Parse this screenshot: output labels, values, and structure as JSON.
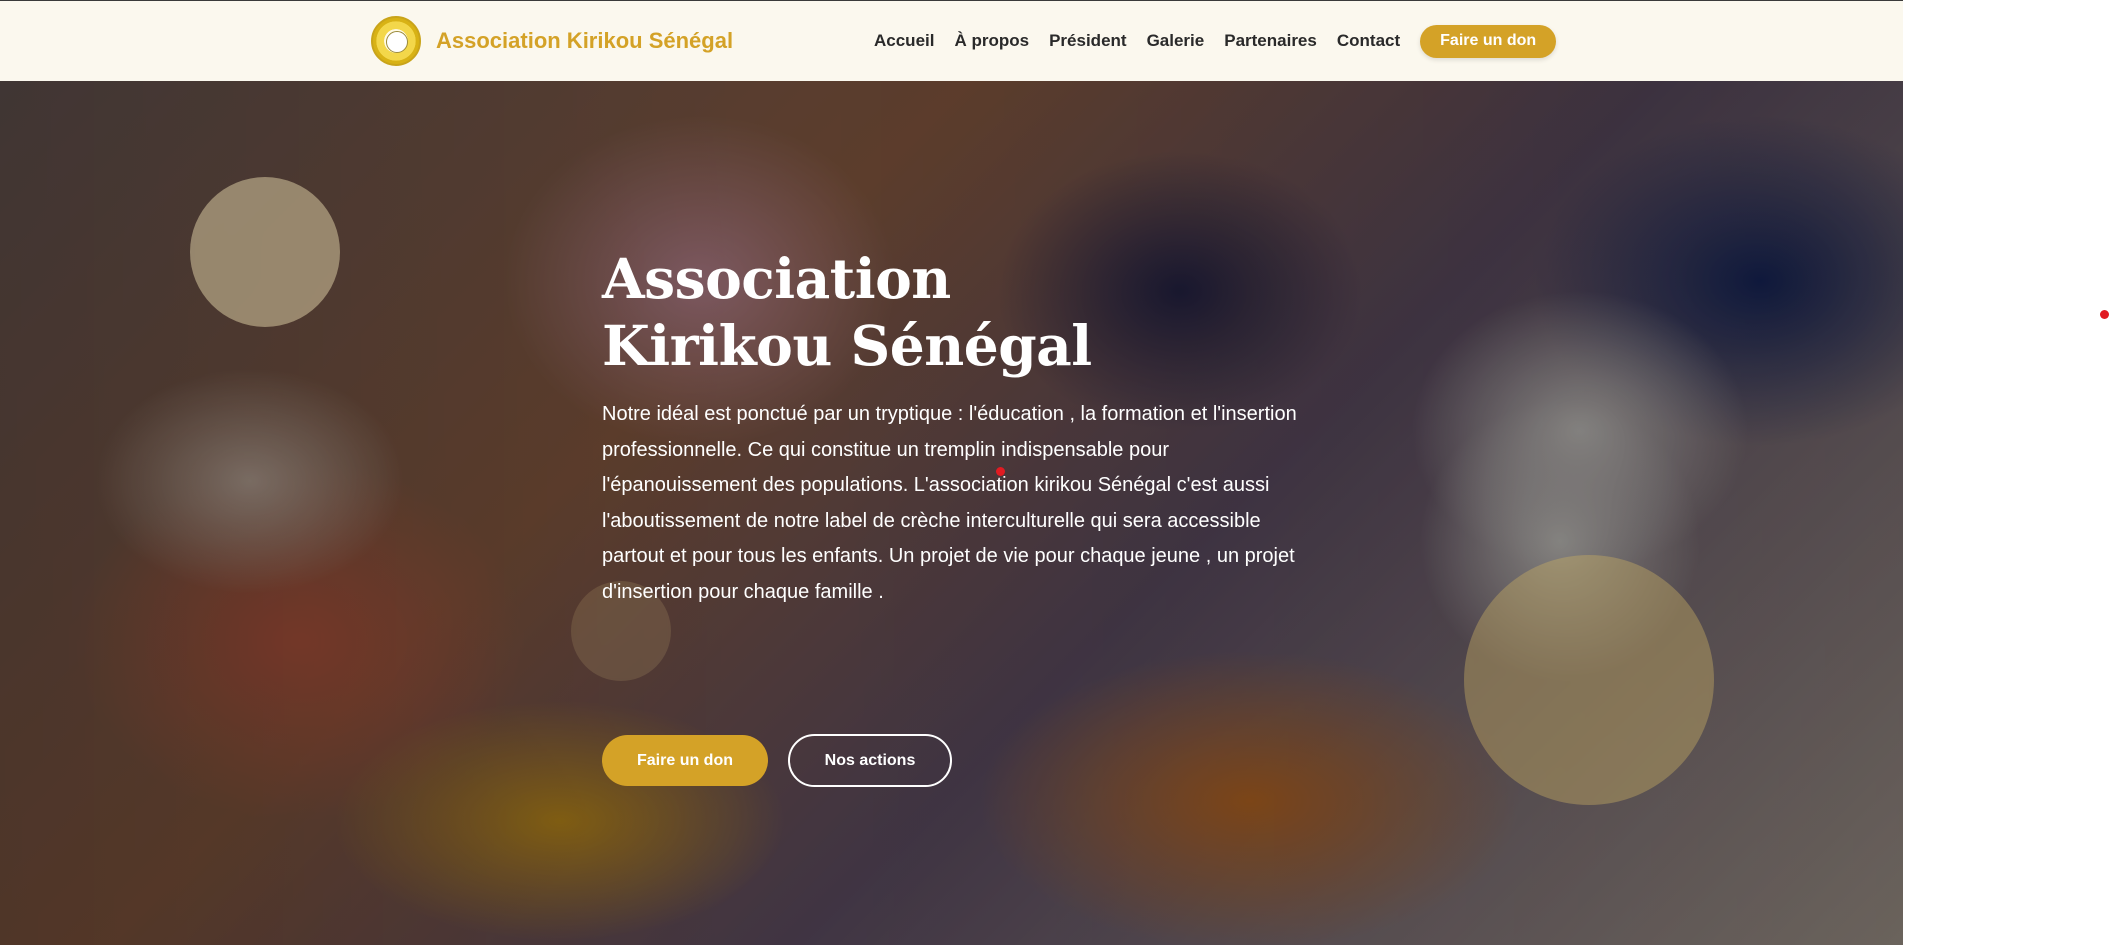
{
  "header": {
    "brand_name": "Association Kirikou Sénégal",
    "nav": [
      "Accueil",
      "À propos",
      "Président",
      "Galerie",
      "Partenaires",
      "Contact"
    ],
    "cta_label": "Faire un don"
  },
  "hero": {
    "title": "Association Kirikou Sénégal",
    "description": "Notre idéal est ponctué par un tryptique : l'éducation , la formation et l'insertion professionnelle. Ce qui constitue un tremplin indispensable pour l'épanouissement des populations. L'association kirikou Sénégal c'est aussi l'aboutissement de notre label de crèche interculturelle qui sera accessible partout et pour tous les enfants. Un projet de vie pour chaque jeune , un projet d'insertion pour chaque famille .",
    "primary_button": "Faire un don",
    "secondary_button": "Nos actions"
  },
  "colors": {
    "accent": "#d4a227",
    "header_bg": "#fbf8ee",
    "nav_text": "#2a2a2a",
    "indicator_dot": "#e11b22"
  },
  "icons": {
    "logo": "association-logo-seal",
    "indicator": "red-dot"
  }
}
